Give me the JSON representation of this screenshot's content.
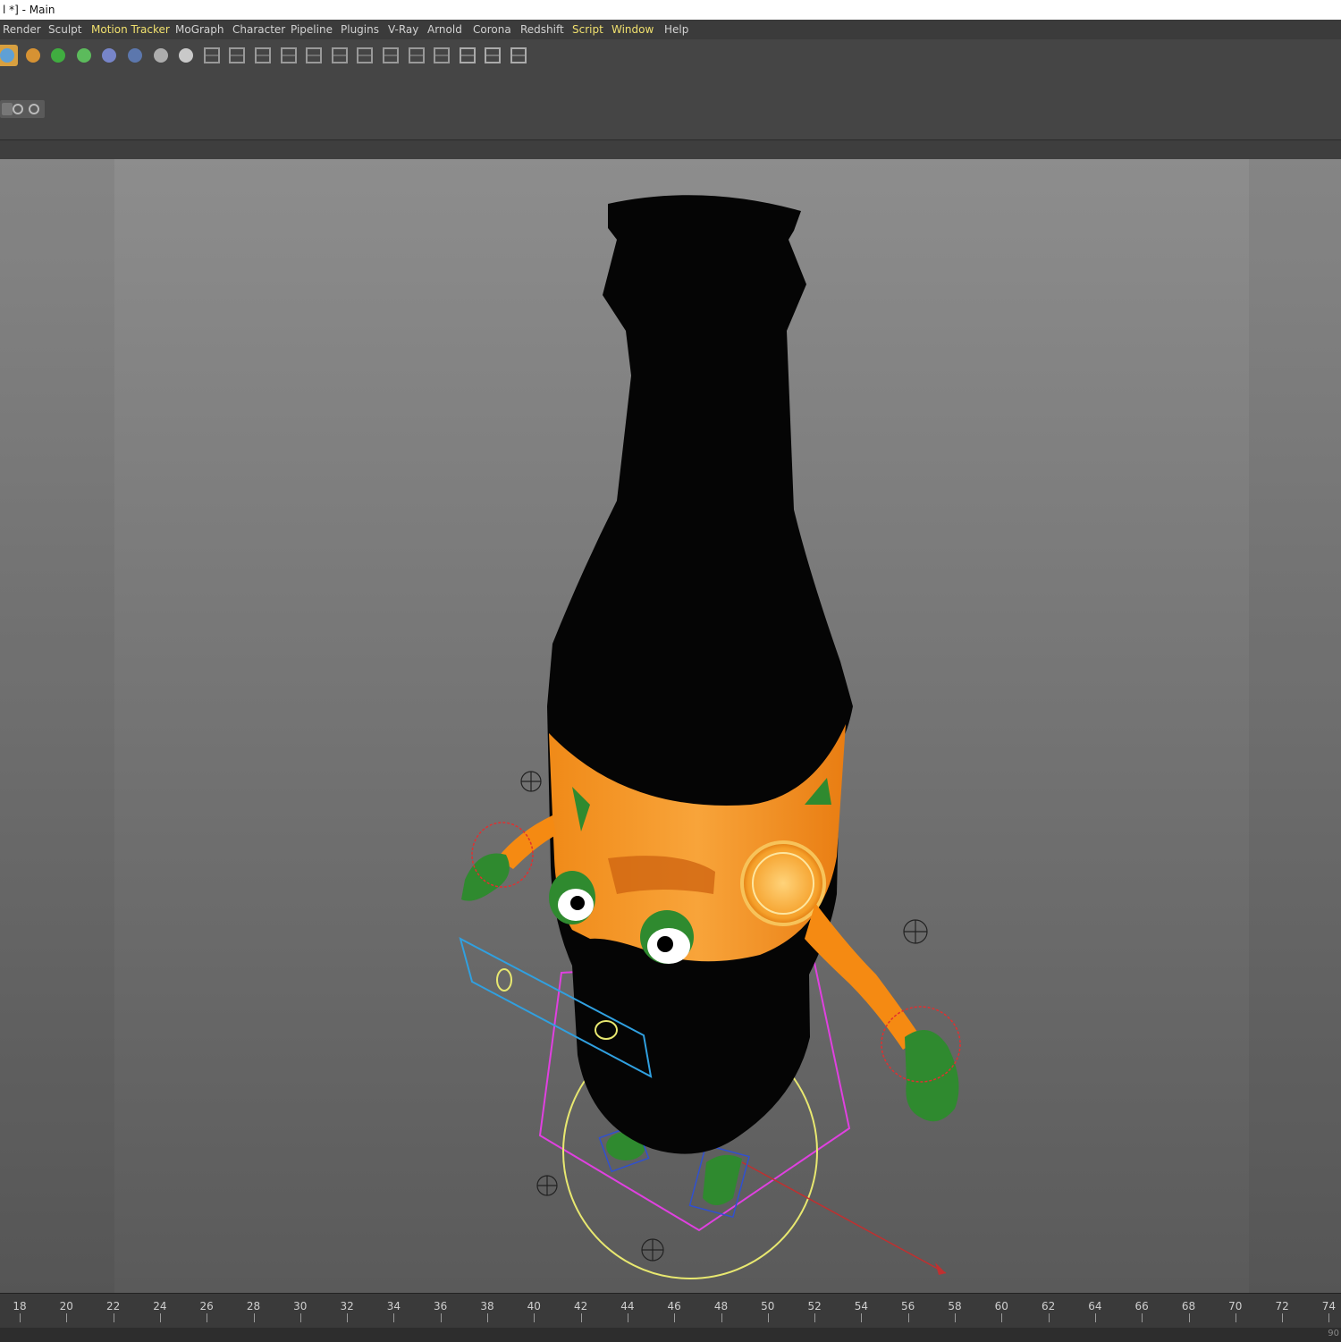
{
  "window": {
    "title": "l *] - Main"
  },
  "menu": [
    {
      "label": "Render",
      "highlight": false
    },
    {
      "label": "Sculpt",
      "highlight": false
    },
    {
      "label": "Motion Tracker",
      "highlight": true
    },
    {
      "label": "MoGraph",
      "highlight": false
    },
    {
      "label": "Character",
      "highlight": false
    },
    {
      "label": "Pipeline",
      "highlight": false
    },
    {
      "label": "Plugins",
      "highlight": false
    },
    {
      "label": "V-Ray",
      "highlight": false
    },
    {
      "label": "Arnold",
      "highlight": false
    },
    {
      "label": "Corona",
      "highlight": false
    },
    {
      "label": "Redshift",
      "highlight": false
    },
    {
      "label": "Script",
      "highlight": true
    },
    {
      "label": "Window",
      "highlight": true
    },
    {
      "label": "Help",
      "highlight": false
    }
  ],
  "toolbar": {
    "icons": [
      "cube-icon",
      "pen-icon",
      "subdivision-icon",
      "cloner-icon",
      "deformer-icon",
      "floor-icon",
      "camera-icon",
      "light-icon",
      "joint-icon",
      "mirror-icon",
      "bone-icon",
      "ik-icon",
      "tree-icon",
      "hierarchy-icon",
      "mesh-icon",
      "object-icon",
      "tag-icon",
      "tag-group-icon",
      "grid-icon",
      "grid-2-icon",
      "grid-3-icon"
    ]
  },
  "viewport": {
    "label_text": "",
    "colors": {
      "label": "#f7941d",
      "body": "#050505",
      "limbs": "#f58a12",
      "gloves": "#2f8a2f"
    }
  },
  "timeline": {
    "ticks": [
      "18",
      "20",
      "22",
      "24",
      "26",
      "28",
      "30",
      "32",
      "34",
      "36",
      "38",
      "40",
      "42",
      "44",
      "46",
      "48",
      "50",
      "52",
      "54",
      "56",
      "58",
      "60",
      "62",
      "64",
      "66",
      "68",
      "70",
      "72",
      "74"
    ],
    "end_frame": "90"
  }
}
